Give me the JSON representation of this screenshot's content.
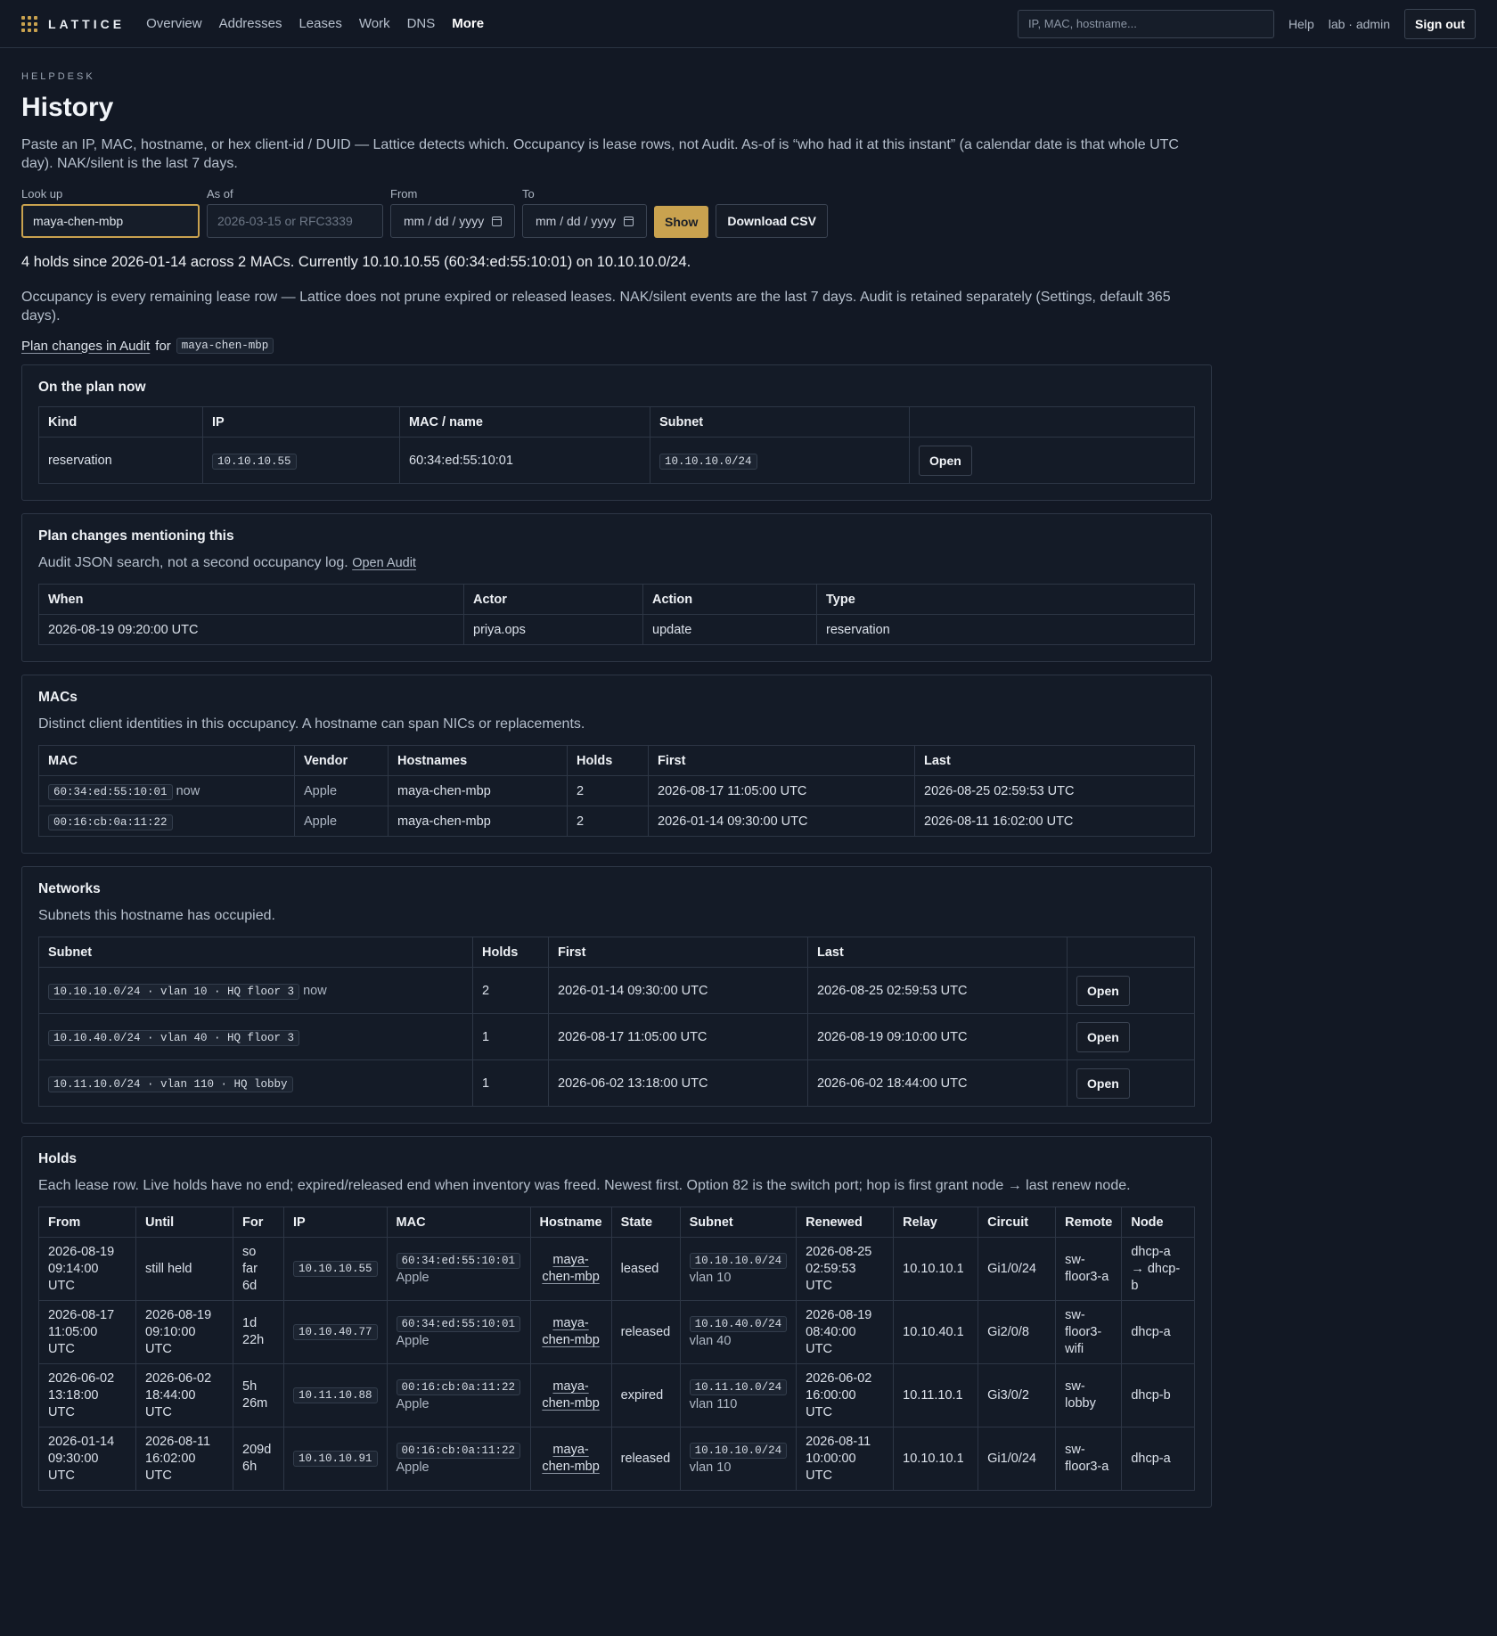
{
  "app": {
    "name": "LATTICE"
  },
  "nav": [
    "Overview",
    "Addresses",
    "Leases",
    "Work",
    "DNS",
    "More"
  ],
  "topbar": {
    "search_placeholder": "IP, MAC, hostname...",
    "help": "Help",
    "user": "lab · admin",
    "signout": "Sign out"
  },
  "page": {
    "eyebrow": "HELPDESK",
    "title": "History",
    "intro": "Paste an IP, MAC, hostname, or hex client-id / DUID — Lattice detects which. Occupancy is lease rows, not Audit. As-of is “who had it at this instant” (a calendar date is that whole UTC day). NAK/silent is the last 7 days."
  },
  "form": {
    "lookup_label": "Look up",
    "lookup_value": "maya-chen-mbp",
    "asof_label": "As of",
    "asof_placeholder": "2026-03-15 or RFC3339",
    "from_label": "From",
    "from_placeholder": "mm / dd / yyyy",
    "to_label": "To",
    "to_placeholder": "mm / dd / yyyy",
    "show": "Show",
    "csv": "Download CSV"
  },
  "summary": "4 holds since 2026-01-14 across 2 MACs. Currently 10.10.10.55 (60:34:ed:55:10:01) on 10.10.10.0/24.",
  "note": "Occupancy is every remaining lease row — Lattice does not prune expired or released leases. NAK/silent events are the last 7 days. Audit is retained separately (Settings, default 365 days).",
  "plan_link": {
    "link": "Plan changes in Audit",
    "for": "for",
    "host": "maya-chen-mbp"
  },
  "plan_now": {
    "title": "On the plan now",
    "headers": [
      "Kind",
      "IP",
      "MAC / name",
      "Subnet",
      ""
    ],
    "rows": [
      {
        "kind": "reservation",
        "ip": "10.10.10.55",
        "mac": "60:34:ed:55:10:01",
        "subnet": "10.10.10.0/24",
        "action": "Open"
      }
    ]
  },
  "plan_changes": {
    "title": "Plan changes mentioning this",
    "desc": "Audit JSON search, not a second occupancy log.",
    "desc_link": "Open Audit",
    "headers": [
      "When",
      "Actor",
      "Action",
      "Type"
    ],
    "rows": [
      {
        "when": "2026-08-19 09:20:00 UTC",
        "actor": "priya.ops",
        "action": "update",
        "type": "reservation"
      }
    ]
  },
  "macs": {
    "title": "MACs",
    "desc": "Distinct client identities in this occupancy. A hostname can span NICs or replacements.",
    "headers": [
      "MAC",
      "Vendor",
      "Hostnames",
      "Holds",
      "First",
      "Last"
    ],
    "rows": [
      {
        "mac": "60:34:ed:55:10:01",
        "tag": "now",
        "vendor": "Apple",
        "host": "maya-chen-mbp",
        "holds": "2",
        "first": "2026-08-17 11:05:00 UTC",
        "last": "2026-08-25 02:59:53 UTC"
      },
      {
        "mac": "00:16:cb:0a:11:22",
        "tag": "",
        "vendor": "Apple",
        "host": "maya-chen-mbp",
        "holds": "2",
        "first": "2026-01-14 09:30:00 UTC",
        "last": "2026-08-11 16:02:00 UTC"
      }
    ]
  },
  "networks": {
    "title": "Networks",
    "desc": "Subnets this hostname has occupied.",
    "headers": [
      "Subnet",
      "Holds",
      "First",
      "Last",
      ""
    ],
    "rows": [
      {
        "subnet": "10.10.10.0/24 · vlan 10 · HQ floor 3",
        "tag": "now",
        "holds": "2",
        "first": "2026-01-14 09:30:00 UTC",
        "last": "2026-08-25 02:59:53 UTC",
        "action": "Open"
      },
      {
        "subnet": "10.10.40.0/24 · vlan 40 · HQ floor 3",
        "tag": "",
        "holds": "1",
        "first": "2026-08-17 11:05:00 UTC",
        "last": "2026-08-19 09:10:00 UTC",
        "action": "Open"
      },
      {
        "subnet": "10.11.10.0/24 · vlan 110 · HQ lobby",
        "tag": "",
        "holds": "1",
        "first": "2026-06-02 13:18:00 UTC",
        "last": "2026-06-02 18:44:00 UTC",
        "action": "Open"
      }
    ]
  },
  "holds": {
    "title": "Holds",
    "desc": "Each lease row. Live holds have no end; expired/released end when inventory was freed. Newest first. Option 82 is the switch port; hop is first grant node → last renew node.",
    "headers": [
      "From",
      "Until",
      "For",
      "IP",
      "MAC",
      "Hostname",
      "State",
      "Subnet",
      "Renewed",
      "Relay",
      "Circuit",
      "Remote",
      "Node"
    ],
    "rows": [
      {
        "from": "2026-08-19 09:14:00 UTC",
        "until": "still held",
        "for": "so far 6d",
        "ip": "10.10.10.55",
        "mac": "60:34:ed:55:10:01",
        "vendor": "Apple",
        "host": "maya-chen-mbp",
        "state": "leased",
        "subnet": "10.10.10.0/24",
        "vlan": "vlan 10",
        "renewed": "2026-08-25 02:59:53 UTC",
        "relay": "10.10.10.1",
        "circuit": "Gi1/0/24",
        "remote": "sw-floor3-a",
        "node": "dhcp-a → dhcp-b"
      },
      {
        "from": "2026-08-17 11:05:00 UTC",
        "until": "2026-08-19 09:10:00 UTC",
        "for": "1d 22h",
        "ip": "10.10.40.77",
        "mac": "60:34:ed:55:10:01",
        "vendor": "Apple",
        "host": "maya-chen-mbp",
        "state": "released",
        "subnet": "10.10.40.0/24",
        "vlan": "vlan 40",
        "renewed": "2026-08-19 08:40:00 UTC",
        "relay": "10.10.40.1",
        "circuit": "Gi2/0/8",
        "remote": "sw-floor3-wifi",
        "node": "dhcp-a"
      },
      {
        "from": "2026-06-02 13:18:00 UTC",
        "until": "2026-06-02 18:44:00 UTC",
        "for": "5h 26m",
        "ip": "10.11.10.88",
        "mac": "00:16:cb:0a:11:22",
        "vendor": "Apple",
        "host": "maya-chen-mbp",
        "state": "expired",
        "subnet": "10.11.10.0/24",
        "vlan": "vlan 110",
        "renewed": "2026-06-02 16:00:00 UTC",
        "relay": "10.11.10.1",
        "circuit": "Gi3/0/2",
        "remote": "sw-lobby",
        "node": "dhcp-b"
      },
      {
        "from": "2026-01-14 09:30:00 UTC",
        "until": "2026-08-11 16:02:00 UTC",
        "for": "209d 6h",
        "ip": "10.10.10.91",
        "mac": "00:16:cb:0a:11:22",
        "vendor": "Apple",
        "host": "maya-chen-mbp",
        "state": "released",
        "subnet": "10.10.10.0/24",
        "vlan": "vlan 10",
        "renewed": "2026-08-11 10:00:00 UTC",
        "relay": "10.10.10.1",
        "circuit": "Gi1/0/24",
        "remote": "sw-floor3-a",
        "node": "dhcp-a"
      }
    ]
  }
}
